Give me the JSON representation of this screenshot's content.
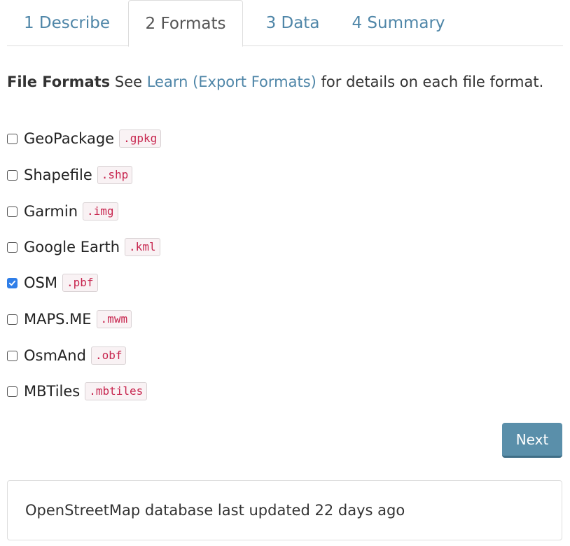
{
  "tabs": [
    {
      "label": "1 Describe",
      "active": false
    },
    {
      "label": "2 Formats",
      "active": true
    },
    {
      "label": "3 Data",
      "active": false
    },
    {
      "label": "4 Summary",
      "active": false
    }
  ],
  "intro": {
    "heading": "File Formats",
    "before_link": "See",
    "link_text": "Learn (Export Formats)",
    "after_link": "for details on each file format."
  },
  "formats": [
    {
      "label": "GeoPackage",
      "ext": ".gpkg",
      "checked": false
    },
    {
      "label": "Shapefile",
      "ext": ".shp",
      "checked": false
    },
    {
      "label": "Garmin",
      "ext": ".img",
      "checked": false
    },
    {
      "label": "Google Earth",
      "ext": ".kml",
      "checked": false
    },
    {
      "label": "OSM",
      "ext": ".pbf",
      "checked": true
    },
    {
      "label": "MAPS.ME",
      "ext": ".mwm",
      "checked": false
    },
    {
      "label": "OsmAnd",
      "ext": ".obf",
      "checked": false
    },
    {
      "label": "MBTiles",
      "ext": ".mbtiles",
      "checked": false
    }
  ],
  "next_label": "Next",
  "status": {
    "text": "OpenStreetMap database last updated 22 days ago"
  },
  "colors": {
    "link": "#4f86a8",
    "button": "#5a8faa",
    "checkbox_checked": "#2f7ee8",
    "code_text": "#c7254e"
  },
  "icons": {
    "checkbox_checked": "check-icon"
  }
}
